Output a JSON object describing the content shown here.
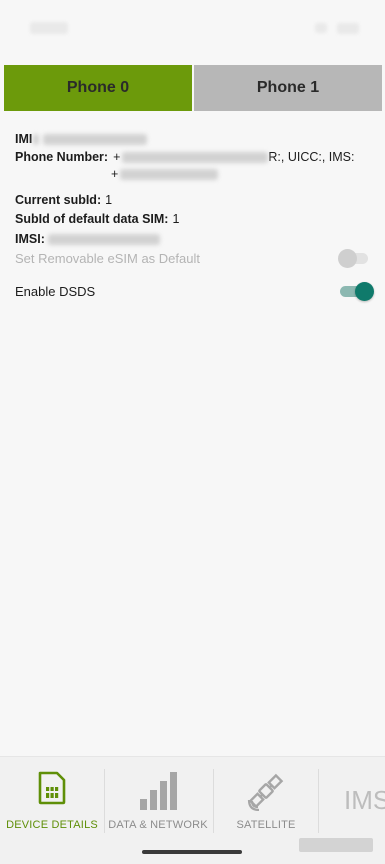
{
  "tabs": [
    {
      "label": "Phone 0",
      "active": true
    },
    {
      "label": "Phone 1",
      "active": false
    }
  ],
  "info": {
    "imei_label": "IMI",
    "phone_number_label": "Phone Number:",
    "phone_number_prefix": "+",
    "phone_number_suffix": "R:, UICC:, IMS:",
    "phone_number_line2_prefix": "+",
    "current_subid_label": "Current subId:",
    "current_subid_value": "1",
    "default_data_subid_label": "SubId of default data SIM:",
    "default_data_subid_value": "1",
    "imsi_label": "IMSI:"
  },
  "settings": {
    "removable_esim": {
      "label": "Set Removable eSIM as Default",
      "enabled": false,
      "checked": false
    },
    "dsds": {
      "label": "Enable DSDS",
      "enabled": true,
      "checked": true
    }
  },
  "bottom_nav": {
    "items": [
      {
        "label": "DEVICE DETAILS",
        "icon": "sim-card-icon",
        "active": true
      },
      {
        "label": "DATA & NETWORK",
        "icon": "signal-bars-icon",
        "active": false
      },
      {
        "label": "SATELLITE",
        "icon": "satellite-icon",
        "active": false
      }
    ],
    "overflow_label": "IMS"
  },
  "colors": {
    "active_tab": "#6c9a0b",
    "inactive_tab": "#b7b7b7",
    "switch_on": "#0f7a6b",
    "nav_active": "#5f8f08"
  }
}
